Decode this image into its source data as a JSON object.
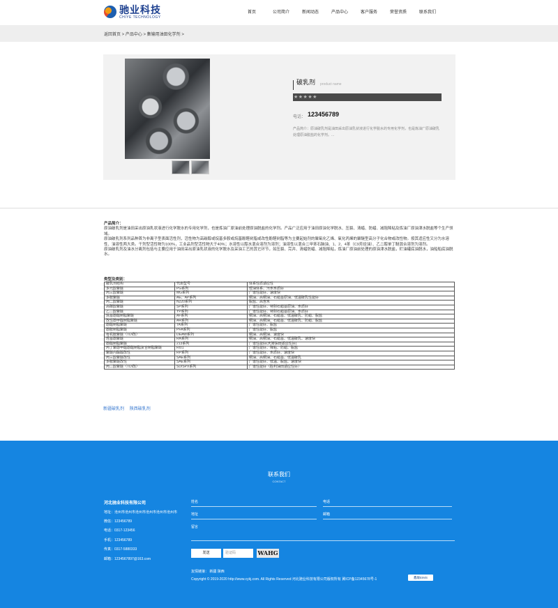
{
  "header": {
    "logo_cn": "驰业科技",
    "logo_en": "CHIYE TECHNOLOGY",
    "nav": [
      "首页",
      "公司简介",
      "新闻动态",
      "产品中心",
      "客户服务",
      "荣誉资质",
      "联系我们"
    ]
  },
  "breadcrumb": "返回首页 > 产品中心 > 集输用油田化学剂 >",
  "product": {
    "name": "破乳剂",
    "name_en": "product name",
    "stars": "★★★★★",
    "phone_label": "电话：",
    "phone": "123456789",
    "intro": "产品简介：原油破乳剂是油田采出原油乳状液进行化学脱水的专用化学剂，也是炼油厂原油破乳处理原油脱盐的化学剂。..."
  },
  "content": {
    "intro_heading": "产品简介：",
    "p1": "原油破乳剂是油田采出原油乳状液进行化学脱水的专用化学剂，也是炼油厂原油前处理原油脱盐的化学剂。产品广泛应用于油田原油化学脱水、压裂、清蜡、防蜡、减阻降粘及炼油厂原油津水脱盐等个生产领域。",
    "p2": "原油破乳剂系列品种首为非离子型表面活性剂，活性物为高碳醇或烷基多胺或烷基酚醛树脂或改性酚醛树脂等为主要起始剂的聚氧化乙烯、氧化丙烯的聚醚型高分子化合物或改性物。按其适应性又分为水溶性、油溶性两大类。干剂型活性物为100%，工业品剂型活性物大于40%；水溶性以醇水混合溶剂为溶剂；油溶性以混合二甲苯石脑油、1、2、4苯（C9芳烃油）、乙二醇单丁醚混合溶剂为溶剂。",
    "p3": "原油破乳剂及油水分离剂包括与主要应用于油田采出原油乳状液的化学脱水及采油工艺的其它环节，如压裂、完井、清蜡防蜡、减阻降粘，炼油厂原油前处理的原油津水脱盐，贮油罐底油脱水，油船船底油脱水。",
    "spec_heading": "类型及类别：",
    "table": [
      [
        "破乳剂结构",
        "代表型号",
        "体系性质适应性"
      ],
      [
        "多元醇聚醚",
        "PG系列",
        "轻油体系、污水水质好"
      ],
      [
        "丙三醇聚醚",
        "MG系列",
        "广谱性能好、速度快"
      ],
      [
        "多胺聚醚",
        "AE、AP系列",
        "稠油、高稠油、石蜡基原油、低温破乳性能好"
      ],
      [
        "丙二醇聚醚",
        "N220系列",
        "脱盐、高含水"
      ],
      [
        "高碳醇聚醚",
        "SP系列",
        "广谱性能好、特别石蜡基原油、水质好"
      ],
      [
        "乙二醇聚醚",
        "YP系列",
        "广谱性能好、特别石蜡基原油、水质好"
      ],
      [
        "烷基酚醛树脂聚醚",
        "AF系列",
        "稠油、高稠油、石蜡基、低温破乳、防蜡、脱盐"
      ],
      [
        "改性酚甲醛树脂聚醚",
        "AR系列",
        "稠油、高稠油、石蜡基、低温破乳、防蜡、脱盐"
      ],
      [
        "酚醛树脂聚醚",
        "TA系列",
        "广谱性能好、脱盐"
      ],
      [
        "酚胺树脂聚醚",
        "PFA系列",
        "广谱性能好、脱盐"
      ],
      [
        "有机胺聚醚（TDI改）",
        "DEAW系列",
        "稠油、高稠油、速度快"
      ],
      [
        "烃基酚聚醚",
        "RA系列",
        "稠油、高稠油、石蜡基、低温破乳、速度快"
      ],
      [
        "酚醛树脂聚醚",
        "213系列",
        "广谱性能好(大港油田适应性好)"
      ],
      [
        "丙丁聚酚甲醛酚醛树脂复合树脂聚醚",
        "RI01",
        "广谱性能好、降粘、防蜡、脱盐"
      ],
      [
        "聚醚内酯酸改性",
        "RP系列",
        "广谱性能好、水质好、速度快"
      ],
      [
        "丙三醇聚醚改性",
        "SAE系列",
        "稠油、高稠油、石蜡基、低温破乳"
      ],
      [
        "多胺聚醚改性",
        "SAE系列",
        "广谱性能好、低温、脱盐、速度快"
      ],
      [
        "丙二醇聚醚（TDI改）",
        "SD/SPX系列",
        "广谱性能好（胜利油田适应性好）"
      ]
    ],
    "tags": [
      "新疆破乳剂",
      "陕西破乳剂"
    ]
  },
  "footer": {
    "title": "联系我们",
    "subtitle": "CONTACT",
    "company": "河北驰业科技有限公司",
    "address": "地址：沧州市沧州市沧州市沧州市沧州市沧州市",
    "wechat": "微信：123456789",
    "tel": "电话：0317-123456",
    "mobile": "手机：123456789",
    "fax": "传真：0317-5880333",
    "email": "邮箱：1234567897@163.com",
    "form": {
      "name": "姓名",
      "phone": "电话",
      "address": "地址",
      "email": "邮箱",
      "message": "留言",
      "send": "发送",
      "captcha_placeholder": "验证码",
      "captcha_code": "WAHG"
    },
    "friend_links": "友情链接：  新疆    陕西",
    "copyright": "Copyright © 2019-2020 http://www.cykj.com. All Rights Reserved 河北驰业科技有限公司版权所有 冀ICP备12345678号-1",
    "badge": "鑫联EIMS"
  }
}
